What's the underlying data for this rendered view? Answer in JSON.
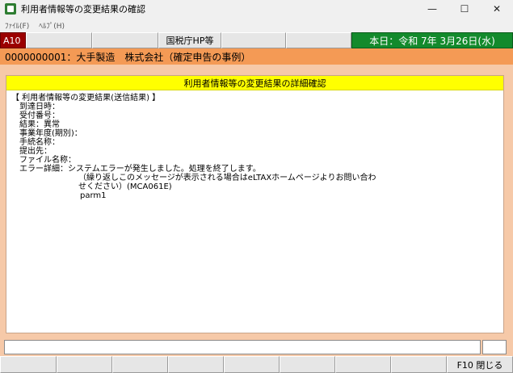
{
  "window": {
    "title": "利用者情報等の変更結果の確認",
    "minimize_glyph": "—",
    "maximize_glyph": "☐",
    "close_glyph": "✕"
  },
  "menu": {
    "file": "ﾌｧｲﾙ(F)",
    "help": "ﾍﾙﾌﾟ(H)"
  },
  "toolbar": {
    "screen_code": "A10",
    "tax_office_hp": "国税庁HP等",
    "today": "本日：令和 7年 3月26日(水)"
  },
  "company": "0000000001：大手製造　株式会社（確定申告の事例）",
  "panel": {
    "header": "利用者情報等の変更結果の詳細確認",
    "lines": {
      "section": "【 利用者情報等の変更結果(送信結果) 】",
      "arrival": "到達日時：",
      "receipt": "受付番号：",
      "result": "結果：異常",
      "fiscal_year": "事業年度(期別)：",
      "procedure": "手続名称：",
      "submit_to": "提出先：",
      "file_name": "ファイル名称：",
      "error_detail": "エラー詳細：システムエラーが発生しました。処理を終了します。",
      "error_more1": "（繰り返しこのメッセージが表示される場合はeLTAXホームページよりお問い合わ",
      "error_more2": "せください）(MCA061E)",
      "parm": "parm1"
    }
  },
  "fkeys": {
    "f10": "F10 閉じる"
  }
}
